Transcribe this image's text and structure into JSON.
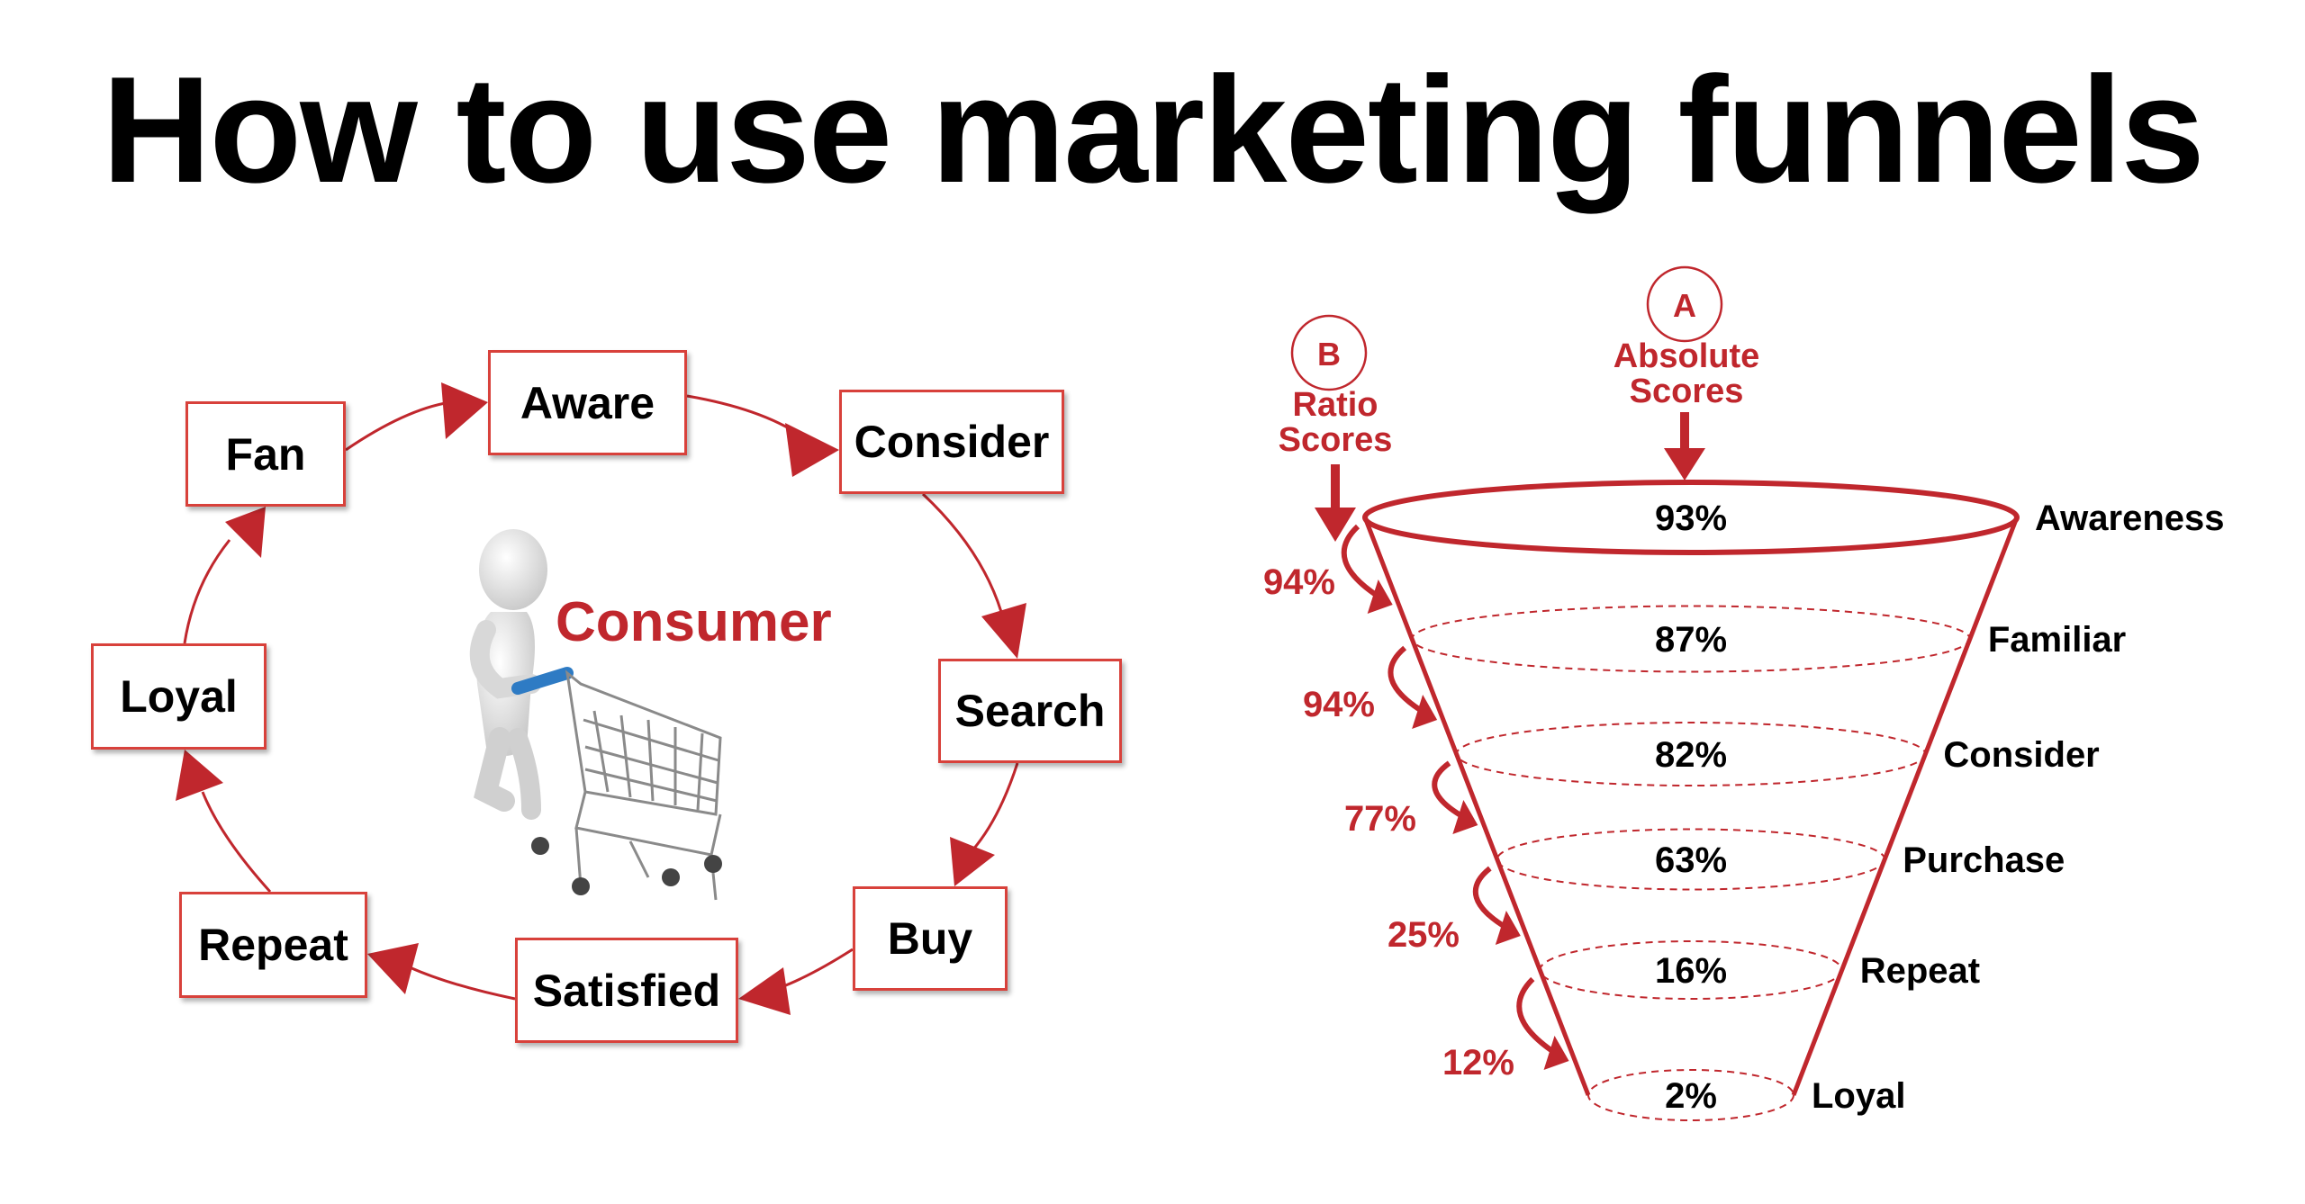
{
  "title": "How to use marketing funnels",
  "cycle": {
    "center_label": "Consumer",
    "stages": [
      "Aware",
      "Consider",
      "Search",
      "Buy",
      "Satisfied",
      "Repeat",
      "Loyal",
      "Fan"
    ]
  },
  "funnel": {
    "marker_a": {
      "letter": "A",
      "label_line1": "Absolute",
      "label_line2": "Scores"
    },
    "marker_b": {
      "letter": "B",
      "label_line1": "Ratio",
      "label_line2": "Scores"
    },
    "levels": [
      {
        "name": "Awareness",
        "absolute": "93%"
      },
      {
        "name": "Familiar",
        "absolute": "87%"
      },
      {
        "name": "Consider",
        "absolute": "82%"
      },
      {
        "name": "Purchase",
        "absolute": "63%"
      },
      {
        "name": "Repeat",
        "absolute": "16%"
      },
      {
        "name": "Loyal",
        "absolute": "2%"
      }
    ],
    "ratios": [
      "94%",
      "94%",
      "77%",
      "25%",
      "12%"
    ]
  },
  "colors": {
    "accent": "#c0272d",
    "box_border": "#d8413b",
    "text": "#000000",
    "cart_handle": "#2e7bc4"
  }
}
